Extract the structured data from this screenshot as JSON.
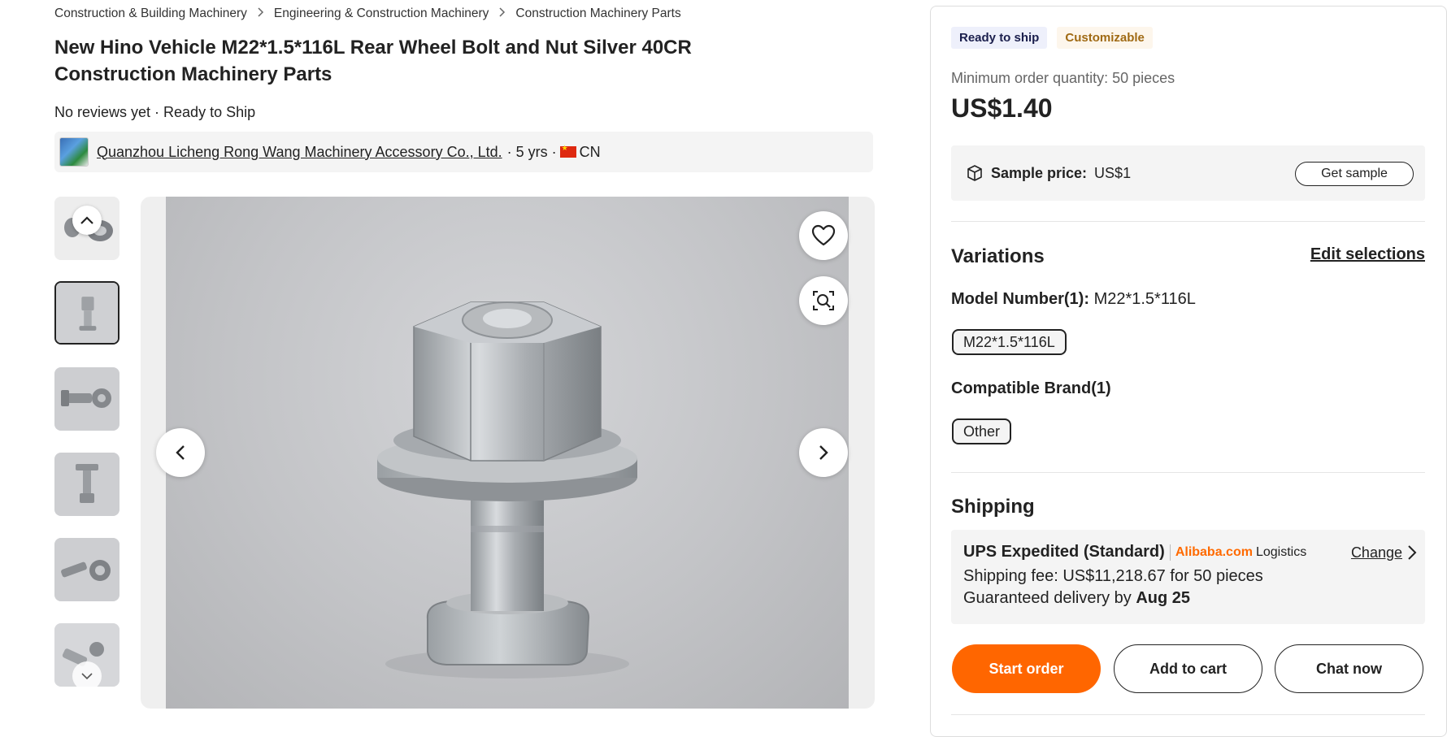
{
  "breadcrumb": [
    "Construction & Building Machinery",
    "Engineering & Construction Machinery",
    "Construction Machinery Parts"
  ],
  "product": {
    "title": "New Hino Vehicle M22*1.5*116L Rear Wheel Bolt and Nut Silver 40CR Construction Machinery Parts",
    "reviews": "No reviews yet · Ready to Ship"
  },
  "supplier": {
    "name": "Quanzhou Licheng Rong Wang Machinery Accessory Co., Ltd.",
    "years": "· 5 yrs ·",
    "country": "CN"
  },
  "gallery": {
    "thumbnail_count": 6,
    "selected_index": 1
  },
  "badges": {
    "ready": "Ready to ship",
    "custom": "Customizable"
  },
  "pricing": {
    "moq": "Minimum order quantity: 50 pieces",
    "price": "US$1.40",
    "sample_label": "Sample price:",
    "sample_value": "US$1",
    "get_sample": "Get sample"
  },
  "variations": {
    "heading": "Variations",
    "edit": "Edit selections",
    "model_label": "Model Number(1):",
    "model_value": "M22*1.5*116L",
    "model_option": "M22*1.5*116L",
    "brand_label": "Compatible Brand(1)",
    "brand_option": "Other"
  },
  "shipping": {
    "heading": "Shipping",
    "method": "UPS Expedited (Standard)",
    "provider": "Alibaba.com",
    "provider_suffix": "Logistics",
    "change": "Change",
    "fee": "Shipping fee: US$11,218.67 for 50 pieces",
    "delivery_prefix": "Guaranteed delivery by",
    "delivery_date": "Aug 25"
  },
  "actions": {
    "start": "Start order",
    "cart": "Add to cart",
    "chat": "Chat now"
  },
  "colors": {
    "accent": "#ff6600",
    "provider": "#ff6a00"
  },
  "icons": [
    "chevron-right-icon",
    "chevron-up-icon",
    "chevron-down-icon",
    "chevron-left-icon",
    "heart-icon",
    "image-search-icon",
    "package-icon",
    "flag-cn-icon"
  ]
}
